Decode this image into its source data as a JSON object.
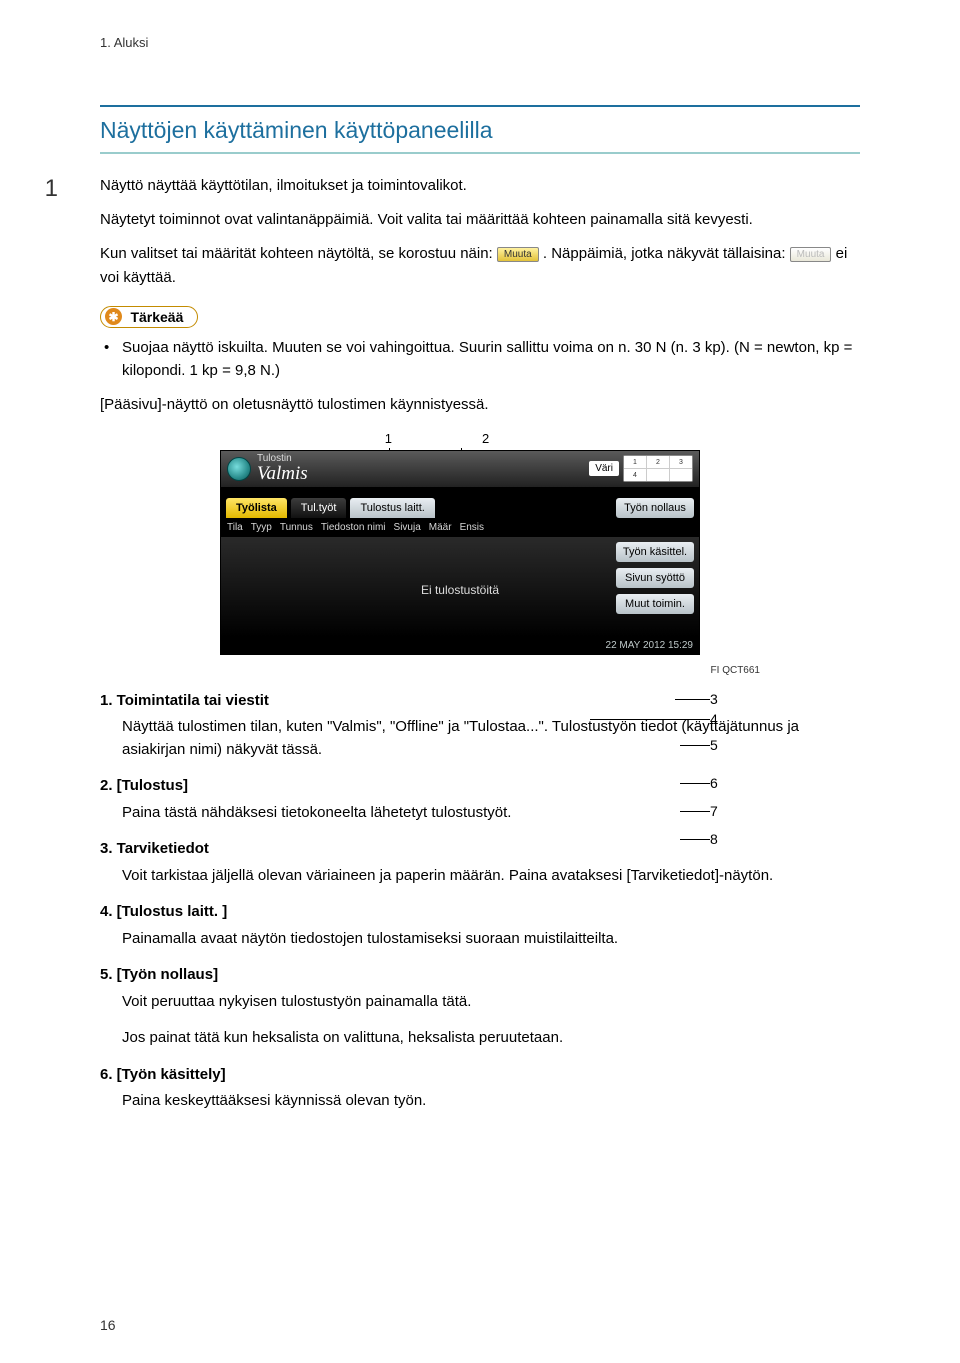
{
  "running_header": "1. Aluksi",
  "chapter_badge": "1",
  "section_title": "Näyttöjen käyttäminen käyttöpaneelilla",
  "para1": "Näyttö näyttää käyttötilan, ilmoitukset ja toimintovalikot.",
  "para2": "Näytetyt toiminnot ovat valintanäppäimiä. Voit valita tai määrittää kohteen painamalla sitä kevyesti.",
  "para3_a": "Kun valitset tai määrität kohteen näytöltä, se korostuu näin: ",
  "para3_b": ". Näppäimiä, jotka näkyvät tällaisina: ",
  "para3_c": " ei voi käyttää.",
  "inline_btn1": "Muuta",
  "inline_btn2": "Muuta",
  "tarkeaa_label": "Tärkeää",
  "bullet1": "Suojaa näyttö iskuilta. Muuten se voi vahingoittua. Suurin sallittu voima on n. 30 N (n. 3 kp). (N = newton, kp = kilopondi. 1 kp = 9,8 N.)",
  "para4": "[Pääsivu]-näyttö on oletusnäyttö tulostimen käynnistyessä.",
  "callouts_top": {
    "c1": "1",
    "c2": "2"
  },
  "callouts_right": {
    "c3": "3",
    "c4": "4",
    "c5": "5",
    "c6": "6",
    "c7": "7",
    "c8": "8"
  },
  "panel": {
    "header_small": "Tulostin",
    "header_status": "Valmis",
    "vari": "Väri",
    "trays": [
      "1",
      "2",
      "3",
      "4",
      "",
      ""
    ],
    "tabs": {
      "tyolista": "Työlista",
      "tultyot": "Tul.työt",
      "tulostus_laitt": "Tulostus laitt."
    },
    "side_buttons": {
      "tyon_nollaus": "Työn nollaus",
      "tyon_kasittel": "Työn käsittel.",
      "sivun_syotto": "Sivun syöttö",
      "muut_toimin": "Muut toimin."
    },
    "cols": [
      "Tila",
      "Tyyp",
      "Tunnus",
      "Tiedoston nimi",
      "Sivuja",
      "Määr",
      "Ensis"
    ],
    "body_msg": "Ei tulostustöitä",
    "footer_time": "22 MAY  2012 15:29"
  },
  "figure_code": "FI QCT661",
  "defs": [
    {
      "dt": "1.  Toimintatila tai viestit",
      "dd": "Näyttää tulostimen tilan, kuten \"Valmis\", \"Offline\" ja \"Tulostaa...\". Tulostustyön tiedot (käyttäjätunnus ja asiakirjan nimi) näkyvät tässä."
    },
    {
      "dt": "2.  [Tulostus]",
      "dd": "Paina tästä nähdäksesi tietokoneelta lähetetyt tulostustyöt."
    },
    {
      "dt": "3.  Tarviketiedot",
      "dd": "Voit tarkistaa jäljellä olevan väriaineen ja paperin määrän. Paina avataksesi [Tarviketiedot]-näytön."
    },
    {
      "dt": "4.  [Tulostus laitt. ]",
      "dd": "Painamalla avaat näytön tiedostojen tulostamiseksi suoraan muistilaitteilta."
    },
    {
      "dt": "5.  [Työn nollaus]",
      "dd": "Voit peruuttaa nykyisen tulostustyön painamalla tätä.",
      "dd2": "Jos painat tätä kun heksalista on valittuna, heksalista peruutetaan."
    },
    {
      "dt": "6.  [Työn käsittely]",
      "dd": "Paina keskeyttääksesi käynnissä olevan työn."
    }
  ],
  "page_number": "16"
}
